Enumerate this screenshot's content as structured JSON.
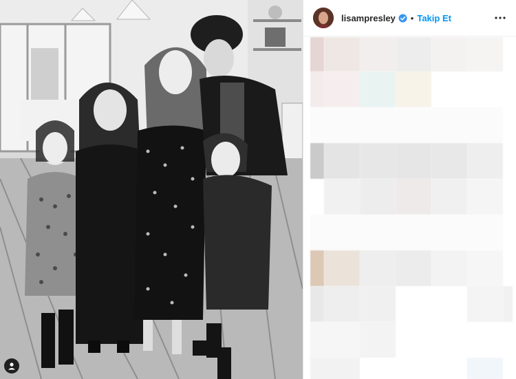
{
  "post": {
    "username": "lisampresley",
    "follow_label": "Takip Et",
    "separator": "•"
  },
  "icons": {
    "verified": "verified-badge-icon",
    "more": "more-options-icon",
    "user_tag": "user-tag-icon"
  },
  "colors": {
    "follow": "#0095f6",
    "verified": "#3897f0"
  }
}
